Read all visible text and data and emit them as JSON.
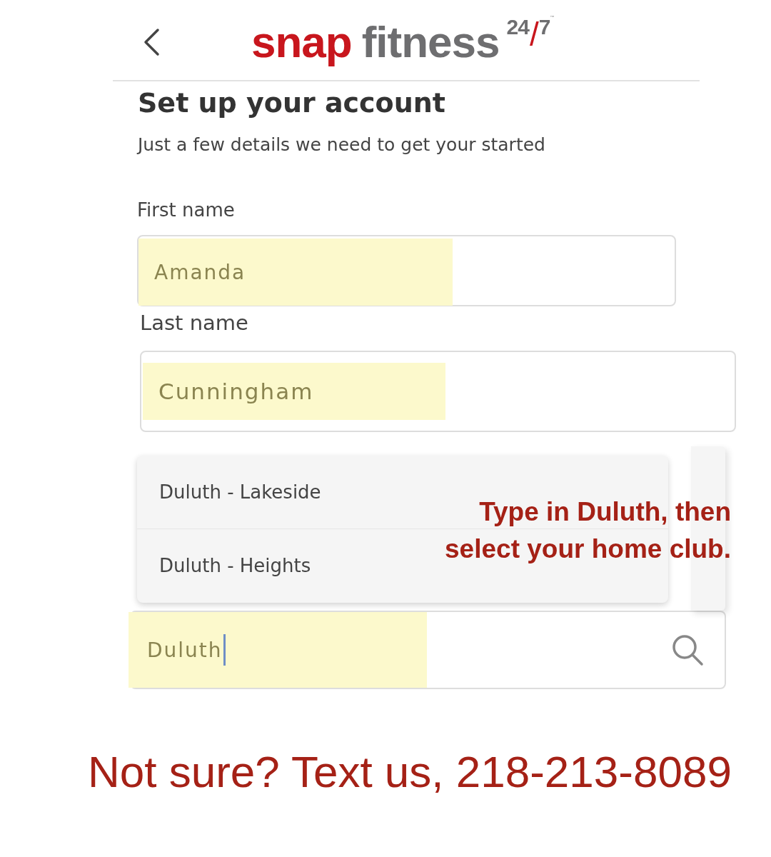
{
  "header": {
    "logo": {
      "word_1": "snap",
      "word_2": "fitness",
      "number_1": "24",
      "slash": "/",
      "number_2": "7",
      "trademark": "™"
    }
  },
  "title": "Set up your account",
  "subtitle": "Just a few details we need to get your started",
  "fields": [
    {
      "label": "First name",
      "value": "Amanda",
      "highlighted": true
    },
    {
      "label": "Last name",
      "value": "Cunningham",
      "highlighted": true
    }
  ],
  "club_search": {
    "value": "Duluth",
    "highlighted": true,
    "focused": true
  },
  "suggestions": [
    {
      "label": "Duluth - Lakeside"
    },
    {
      "label": "Duluth - Heights"
    }
  ],
  "annotation": "Type in Duluth, then select your home club.",
  "footer": "Not sure? Text us, 218-213-8089"
}
